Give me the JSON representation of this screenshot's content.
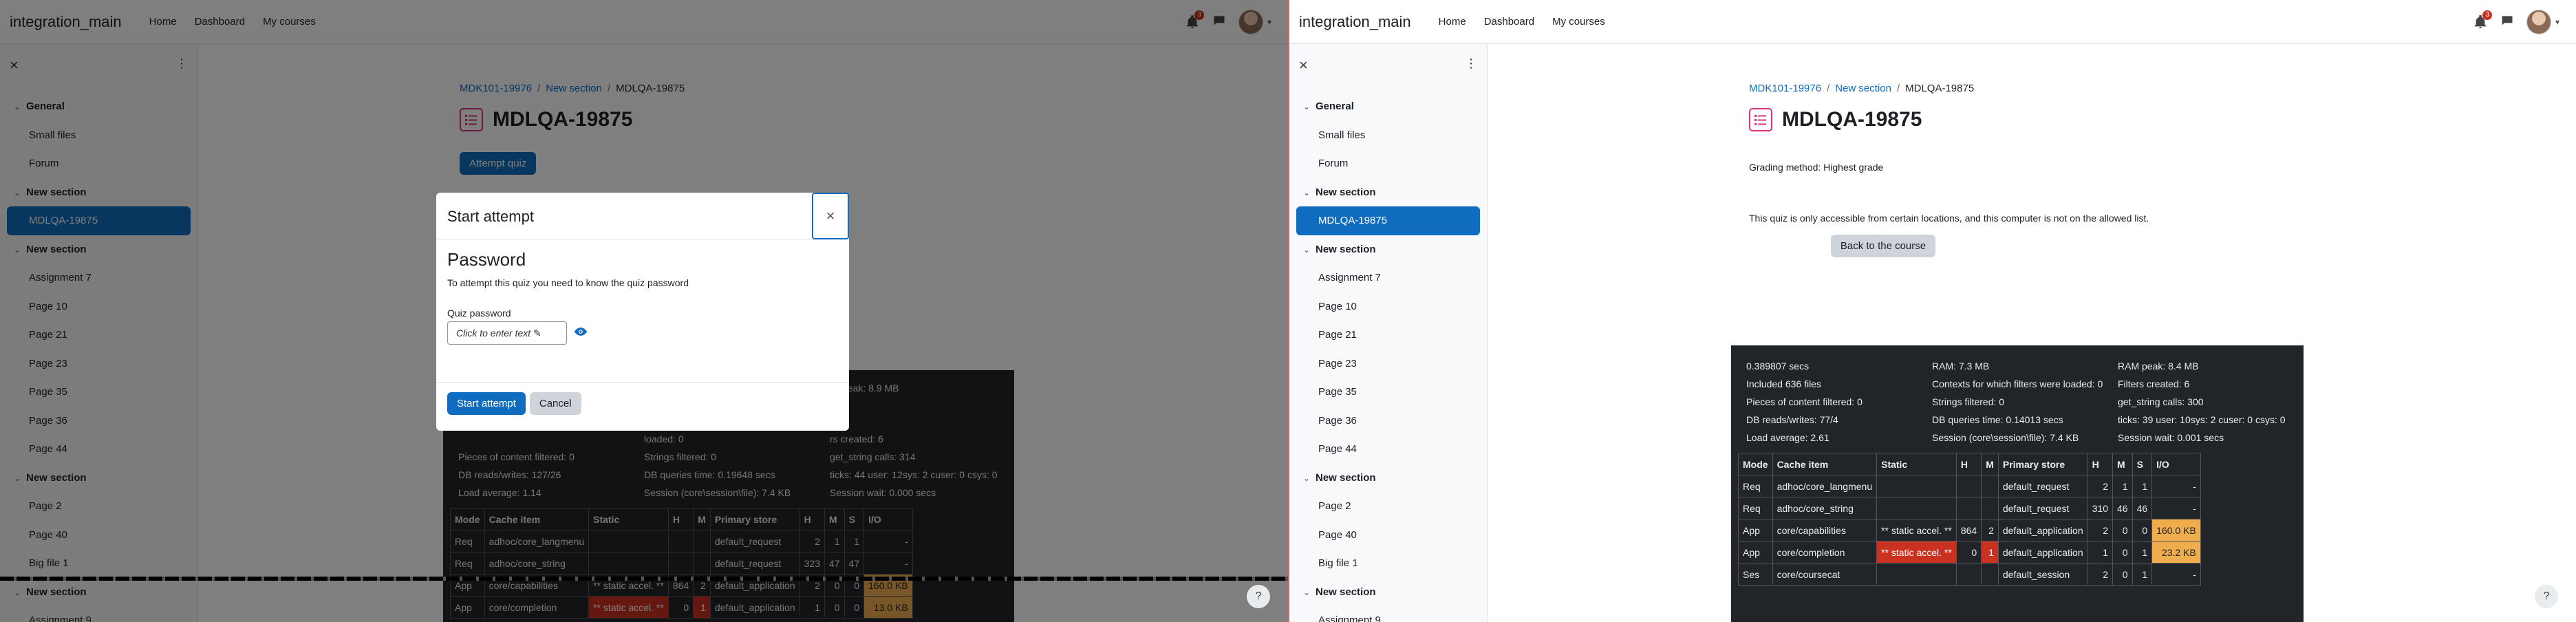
{
  "app": {
    "brand": "integration_main",
    "nav": [
      "Home",
      "Dashboard",
      "My courses"
    ],
    "notif_count": "3"
  },
  "sidebar": [
    {
      "type": "sect",
      "label": "General"
    },
    {
      "type": "item",
      "label": "Small files"
    },
    {
      "type": "item",
      "label": "Forum"
    },
    {
      "type": "sect",
      "label": "New section"
    },
    {
      "type": "active",
      "label": "MDLQA-19875"
    },
    {
      "type": "sect",
      "label": "New section"
    },
    {
      "type": "item",
      "label": "Assignment 7"
    },
    {
      "type": "item",
      "label": "Page 10"
    },
    {
      "type": "item",
      "label": "Page 21"
    },
    {
      "type": "item",
      "label": "Page 23"
    },
    {
      "type": "item",
      "label": "Page 35"
    },
    {
      "type": "item",
      "label": "Page 36"
    },
    {
      "type": "item",
      "label": "Page 44"
    },
    {
      "type": "sect",
      "label": "New section"
    },
    {
      "type": "item",
      "label": "Page 2"
    },
    {
      "type": "item",
      "label": "Page 40"
    },
    {
      "type": "item",
      "label": "Big file 1"
    },
    {
      "type": "sect",
      "label": "New section"
    },
    {
      "type": "item",
      "label": "Assignment 9"
    }
  ],
  "breadcrumb": {
    "course": "MDK101-19976",
    "section": "New section",
    "current": "MDLQA-19875"
  },
  "title": "MDLQA-19875",
  "left": {
    "attempt_button": "Attempt quiz",
    "modal": {
      "title": "Start attempt",
      "close": "×",
      "heading": "Password",
      "text": "To attempt this quiz you need to know the quiz password",
      "field_label": "Quiz password",
      "field_placeholder": "Click to enter text ✎",
      "start": "Start attempt",
      "cancel": "Cancel"
    },
    "perf": {
      "rows": [
        [
          "",
          "loaded: 0",
          "rs created: 6"
        ],
        [
          "Pieces of content filtered: 0",
          "Strings filtered: 0",
          "get_string calls: 314"
        ],
        [
          "DB reads/writes: 127/26",
          "DB queries time: 0.19648 secs",
          "ticks: 44 user: 12sys: 2 cuser: 0 csys: 0"
        ],
        [
          "Load average: 1.14",
          "Session (core\\session\\file): 7.4 KB",
          "Session wait: 0.000 secs"
        ]
      ],
      "peak": "peak: 8.9 MB",
      "headers": [
        "Mode",
        "Cache item",
        "Static",
        "H",
        "M",
        "Primary store",
        "H",
        "M",
        "S",
        "I/O"
      ],
      "cache": [
        [
          "Req",
          "adhoc/core_langmenu",
          "",
          "",
          "",
          "default_request",
          "2",
          "1",
          "1",
          "-"
        ],
        [
          "Req",
          "adhoc/core_string",
          "",
          "",
          "",
          "default_request",
          "323",
          "47",
          "47",
          "-"
        ],
        [
          "App",
          "core/capabilities",
          "** static accel. **",
          "864",
          "2",
          "default_application",
          "2",
          "0",
          "0",
          "160.0 KB"
        ],
        [
          "App",
          "core/completion",
          "** static accel. **",
          "0",
          "1",
          "default_application",
          "1",
          "0",
          "0",
          "13.0 KB"
        ]
      ]
    }
  },
  "right": {
    "grading": "Grading method: Highest grade",
    "notice": "This quiz is only accessible from certain locations, and this computer is not on the allowed list.",
    "back_button": "Back to the course",
    "perf": {
      "rows": [
        [
          "0.389807 secs",
          "RAM: 7.3 MB",
          "RAM peak: 8.4 MB"
        ],
        [
          "Included 636 files",
          "Contexts for which filters were loaded: 0",
          "Filters created: 6"
        ],
        [
          "Pieces of content filtered: 0",
          "Strings filtered: 0",
          "get_string calls: 300"
        ],
        [
          "DB reads/writes: 77/4",
          "DB queries time: 0.14013 secs",
          "ticks: 39 user: 10sys: 2 cuser: 0 csys: 0"
        ],
        [
          "Load average: 2.61",
          "Session (core\\session\\file): 7.4 KB",
          "Session wait: 0.001 secs"
        ]
      ],
      "headers": [
        "Mode",
        "Cache item",
        "Static",
        "H",
        "M",
        "Primary store",
        "H",
        "M",
        "S",
        "I/O"
      ],
      "cache": [
        [
          "Req",
          "adhoc/core_langmenu",
          "",
          "",
          "",
          "default_request",
          "2",
          "1",
          "1",
          "-"
        ],
        [
          "Req",
          "adhoc/core_string",
          "",
          "",
          "",
          "default_request",
          "310",
          "46",
          "46",
          "-"
        ],
        [
          "App",
          "core/capabilities",
          "** static accel. **",
          "864",
          "2",
          "default_application",
          "2",
          "0",
          "0",
          "160.0 KB"
        ],
        [
          "App",
          "core/completion",
          "** static accel. **",
          "0",
          "1",
          "default_application",
          "1",
          "0",
          "1",
          "23.2 KB"
        ],
        [
          "Ses",
          "core/coursecat",
          "",
          "",
          "",
          "default_session",
          "2",
          "0",
          "1",
          "-"
        ]
      ]
    }
  },
  "help": "?"
}
